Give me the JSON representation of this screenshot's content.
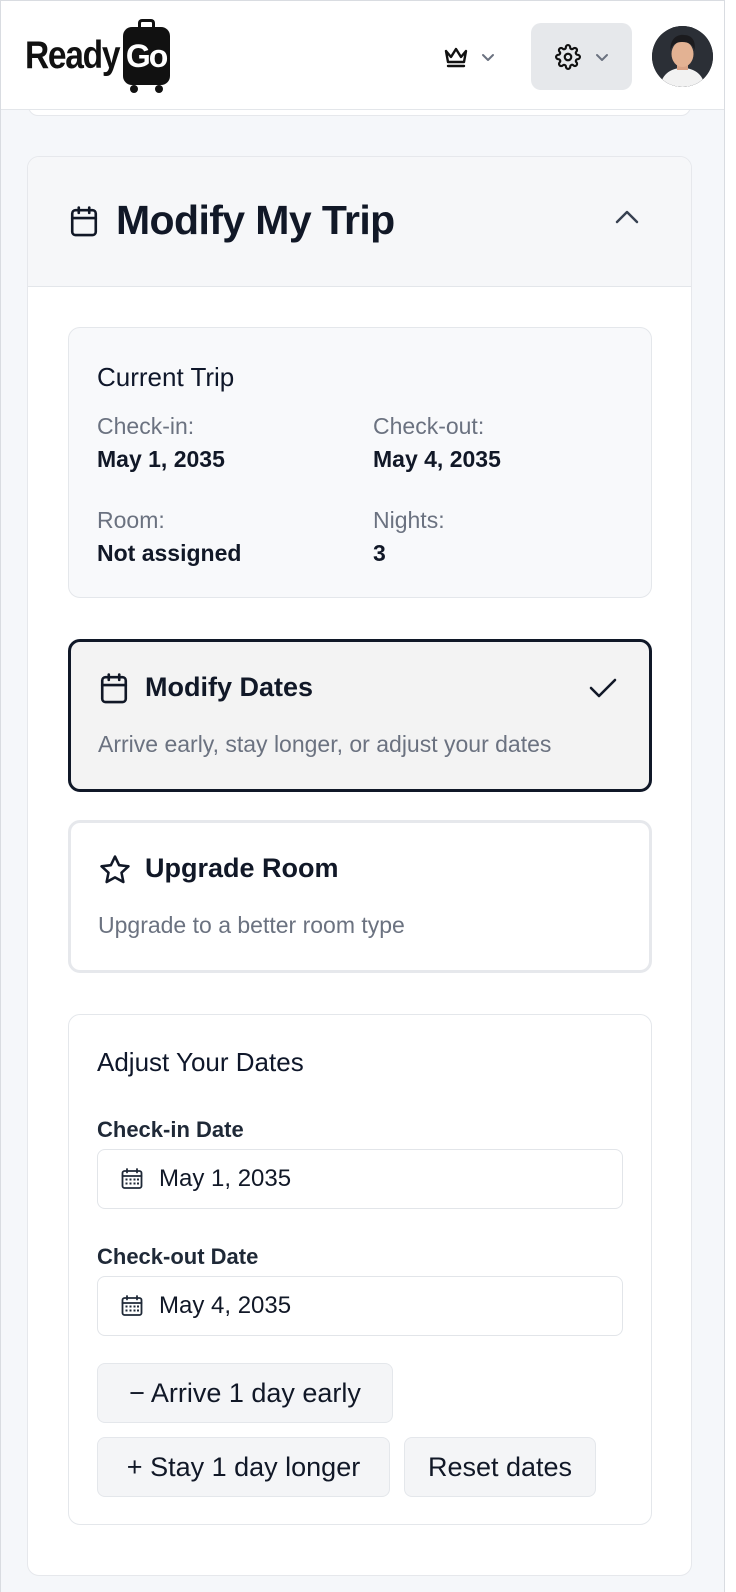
{
  "header": {
    "logo_text": "Ready",
    "logo_badge": "Go",
    "icons": {
      "membership": "crown-icon",
      "settings": "gear-icon",
      "dropdown": "chevron-down-icon"
    }
  },
  "trip_card": {
    "title": "Modify My Trip",
    "title_icon": "calendar-icon",
    "collapse_icon": "chevron-up-icon",
    "current_trip": {
      "title": "Current Trip",
      "checkin_label": "Check-in:",
      "checkin_value": "May 1, 2035",
      "checkout_label": "Check-out:",
      "checkout_value": "May 4, 2035",
      "room_label": "Room:",
      "room_value": "Not assigned",
      "nights_label": "Nights:",
      "nights_value": "3"
    },
    "options": [
      {
        "title": "Modify Dates",
        "description": "Arrive early, stay longer, or adjust your dates",
        "icon": "calendar-icon",
        "selected": true
      },
      {
        "title": "Upgrade Room",
        "description": "Upgrade to a better room type",
        "icon": "star-icon",
        "selected": false
      }
    ],
    "adjust": {
      "title": "Adjust Your Dates",
      "checkin_label": "Check-in Date",
      "checkin_value": "May 1, 2035",
      "checkout_label": "Check-out Date",
      "checkout_value": "May 4, 2035",
      "arrive_early_label": "− Arrive 1 day early",
      "stay_longer_label": "+ Stay 1 day longer",
      "reset_label": "Reset dates"
    }
  },
  "colors": {
    "selected_border": "#101828",
    "muted_text": "#6b7280",
    "header_bg": "#f6f7f9",
    "page_bg": "#f5f7fa"
  }
}
